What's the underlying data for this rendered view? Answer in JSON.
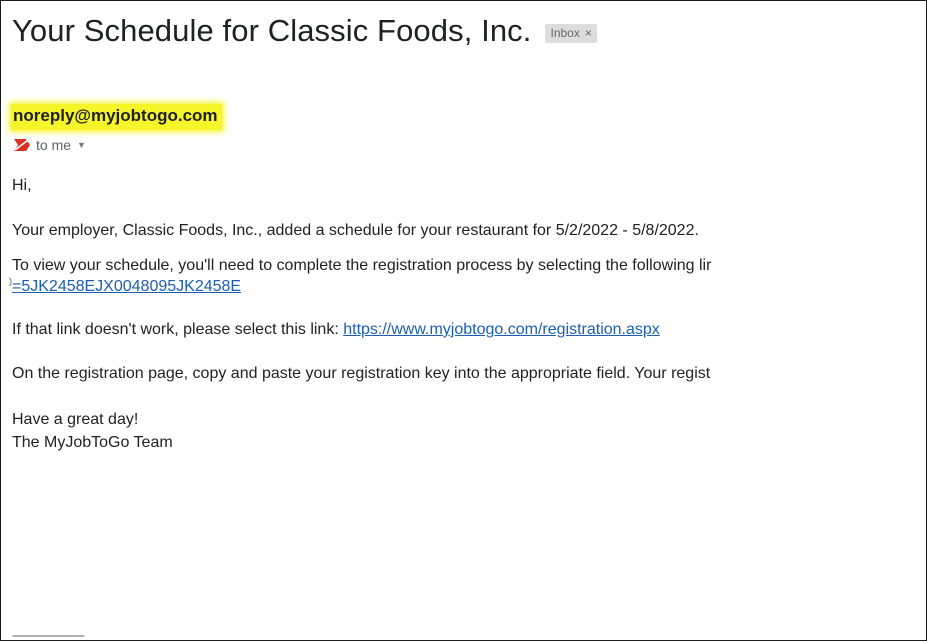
{
  "email": {
    "subject": "Your Schedule for Classic Foods, Inc.",
    "label": "Inbox",
    "label_close": "×",
    "sender": "noreply@myjobtogo.com",
    "recipient": "to me",
    "recipient_chevron": "▼",
    "highlight_color": "#f6f52a",
    "link_color": "#1a5fb4",
    "body": {
      "greeting": "Hi,",
      "line1": "Your employer, Classic Foods, Inc., added a schedule for your restaurant for 5/2/2022 - 5/8/2022.",
      "line2": "To view your schedule, you'll need to complete the registration process by selecting the following lir",
      "registration_link_tail": "=5JK2458EJX0048095JK2458E",
      "line3_prefix": "If that link doesn't work, please select this link: ",
      "registration_url": "https://www.myjobtogo.com/registration.aspx",
      "line4": "On the registration page, copy and paste your registration key into the appropriate field. Your regist",
      "closing": "Have a great day!",
      "signature": "The MyJobToGo Team",
      "separator": "------------------------"
    }
  },
  "icons": {
    "important_marker": "important-marker-icon"
  }
}
